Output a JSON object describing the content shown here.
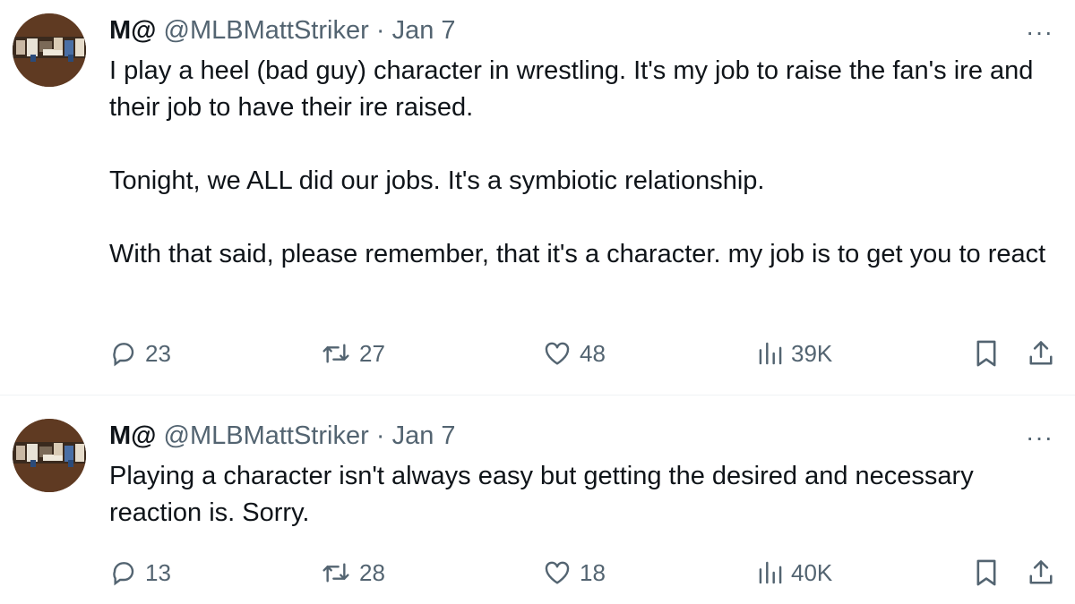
{
  "tweets": [
    {
      "display_name": "M@",
      "handle": "@MLBMattStriker",
      "separator": "·",
      "date": "Jan 7",
      "more": "···",
      "paragraphs": [
        "I play a heel (bad guy) character in wrestling.  It's my job to raise the fan's ire and their job to have their ire raised.",
        "Tonight,  we ALL did our jobs.  It's a symbiotic relationship.",
        "With that said, please remember, that it's a character. my job is to get you to react"
      ],
      "replies": "23",
      "reposts": "27",
      "likes": "48",
      "views": "39K"
    },
    {
      "display_name": "M@",
      "handle": "@MLBMattStriker",
      "separator": "·",
      "date": "Jan 7",
      "more": "···",
      "paragraphs": [
        "Playing a character isn't always easy but getting the desired and necessary reaction is. Sorry."
      ],
      "replies": "13",
      "reposts": "28",
      "likes": "18",
      "views": "40K"
    }
  ],
  "icons": {
    "reply": "reply-icon",
    "repost": "repost-icon",
    "like": "heart-icon",
    "views": "views-chart-icon",
    "bookmark": "bookmark-icon",
    "share": "share-icon",
    "more": "more-options-icon"
  },
  "colors": {
    "text": "#0f1419",
    "secondary": "#536471",
    "divider": "#eff3f4",
    "avatar_bg": "#5f3a22"
  }
}
